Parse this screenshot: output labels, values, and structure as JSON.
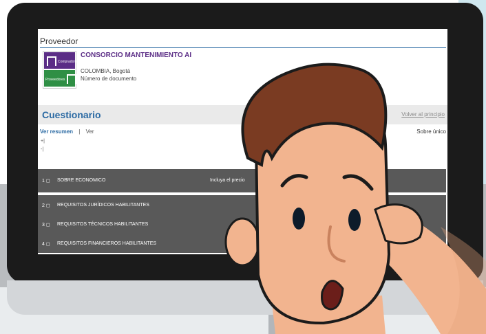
{
  "section_title": "Proveedor",
  "logo": {
    "top_label": "Compradores",
    "bottom_label": "Proveedores"
  },
  "provider": {
    "name": "CONSORCIO MANTENIMIENTO AI",
    "location": "COLOMBIA, Bogotá",
    "document": "Número de documento"
  },
  "questionnaire": {
    "title": "Cuestionario",
    "back_link": "Volver al principio",
    "summary_link": "Ver resumen",
    "separator": "|",
    "view_link": "Ver",
    "envelope": "Sobre único",
    "marks": [
      "+|",
      "-|"
    ]
  },
  "rows": [
    {
      "num": "1 ◻",
      "label": "SOBRE ECONOMICO",
      "extra": "Incluya el precio"
    },
    {
      "num": "2 ◻",
      "label": "REQUISITOS JURÍDICOS HABILITANTES"
    },
    {
      "num": "3 ◻",
      "label": "REQUISITOS TÉCNICOS HABILITANTES"
    },
    {
      "num": "4 ◻",
      "label": "REQUISITOS FINANCIEROS HABILITANTES"
    }
  ],
  "colors": {
    "accent": "#2b6aa3",
    "purple": "#5b2d86",
    "green": "#2f8f45",
    "row": "#595959"
  }
}
